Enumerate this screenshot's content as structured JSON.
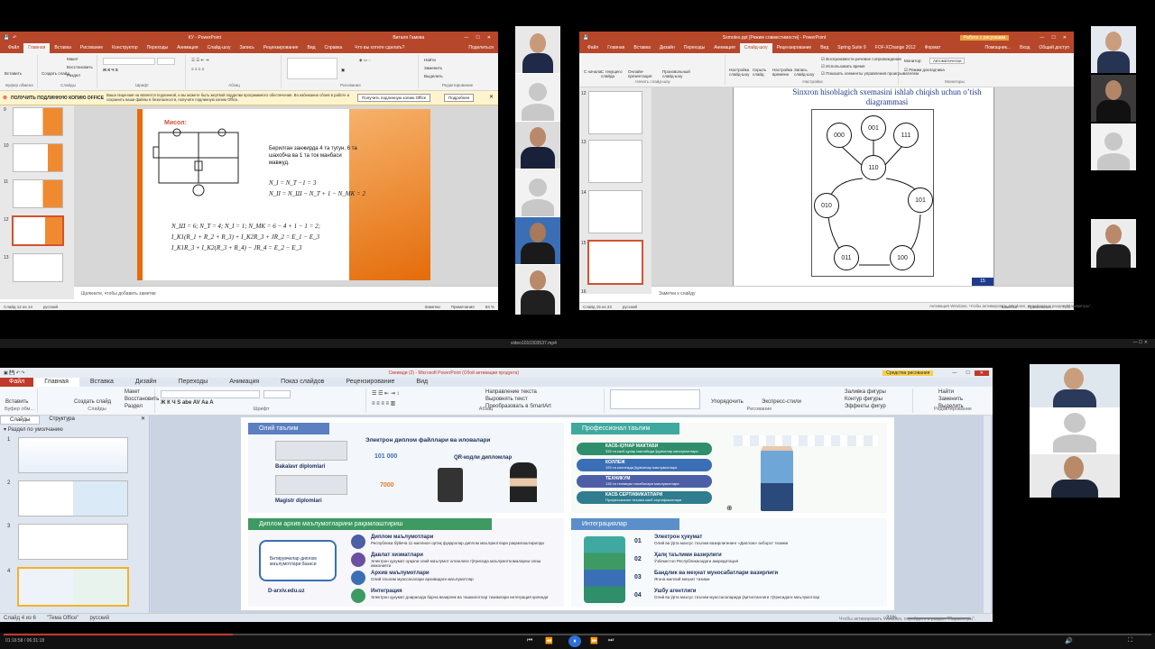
{
  "win1": {
    "title": "КУ - PowerPoint",
    "user": "Виталя Гамева",
    "share": "Поделиться",
    "tabs": [
      "Файл",
      "Главная",
      "Вставка",
      "Рисование",
      "Конструктор",
      "Переходы",
      "Анимация",
      "Слайд-шоу",
      "Запись",
      "Рецензирование",
      "Вид",
      "Справка"
    ],
    "tell": "Что вы хотите сделать?",
    "buttons": [
      "Вставить",
      "Создать слайд",
      "Макет",
      "Восстановить",
      "Раздел",
      "Найти",
      "Заменить",
      "Выделить"
    ],
    "groups": [
      "Буфер обмена",
      "Слайды",
      "Шрифт",
      "Абзац",
      "Рисование",
      "Редактирование"
    ],
    "notice_title": "ПОЛУЧИТЬ ПОДЛИННУЮ КОПИЮ OFFICE",
    "notice_text": "Ваша лицензия на является подлинной, и вы можете быть жертвой подделки программного обеспечения. Во избежание сбоев в работе и сохранить ваши файлы в безопасности, получите подлинную копию Office.",
    "notice_btn1": "Получить подлинную копию Office",
    "notice_btn2": "Подробнее",
    "thumb_nums": [
      "9",
      "10",
      "11",
      "12",
      "13"
    ],
    "slide": {
      "heading": "Мисол:",
      "bullet": "Берилган занжирда 4 та тугун, 6 та шахобча ва 1 та ток манбаси мавжуд.",
      "eq1": "N_I = N_T −1 = 3",
      "eq2": "N_II = N_Ш − N_T + 1 − N_МК = 2",
      "eq3": "N_Ш = 6;   N_T = 4;   N_I = 1; N_МК = 6 − 4 + 1 − 1 = 2;",
      "eq4": "I_K1(R_1 + R_2 + R_3) + I_K2R_3 + JR_2 = E_1 − E_3",
      "eq5": "I_K1R_3 + I_K2(R_3 + R_4) − JR_4 = E_2 − E_3"
    },
    "notes": "Щелкните, чтобы добавить заметки",
    "status_left": "Слайд 12 из 14",
    "status_lang": "русский",
    "status_notes": "Заметки",
    "status_comments": "Примечания",
    "zoom": "83 %"
  },
  "win2": {
    "title": "Sxmotex.ppt [Режим совместимости] - PowerPoint",
    "context": "Работа с рисунками",
    "tabs": [
      "Файл",
      "Главная",
      "Вставка",
      "Дизайн",
      "Переходы",
      "Анимация",
      "Слайд-шоу",
      "Рецензирование",
      "Вид",
      "Spring Suite 9",
      "FOF-XChange 2012",
      "Формат"
    ],
    "help": "Помощник...",
    "login": "Вход",
    "share": "Общий доступ",
    "buttons": [
      "С начала",
      "С текущего слайда",
      "Онлайн-презентация",
      "Произвольный слайд-шоу",
      "Настройка слайд-шоу",
      "Скрыть слайд",
      "Настройка времени",
      "Запись слайд-шоу"
    ],
    "checks": [
      "Воспроизвести речевое сопровождение",
      "Использовать время",
      "Показать элементы управления проигрывателем"
    ],
    "monitor_label": "Монитор:",
    "monitor_value": "Автоматически",
    "presenter": "Режим докладчика",
    "groups": [
      "Начать слайд-шоу",
      "Настройка",
      "Мониторы"
    ],
    "thumb_nums": [
      "12",
      "13",
      "14",
      "15",
      "16"
    ],
    "slide_title": "Sinxron hisoblagich sxemasini ishlab chiqish uchun o’tish diagrammasi",
    "nodes": [
      "000",
      "001",
      "111",
      "110",
      "010",
      "101",
      "011",
      "100"
    ],
    "slide_no": "15",
    "notes": "Заметки к слайду",
    "status_left": "Слайд 15 из 23",
    "status_lang": "русский",
    "status_notes": "Заметки",
    "status_comments": "Примечания",
    "zoom": "73%"
  },
  "top_overlay": "Активация Windows. Чтобы активировать Windows, перейдите в раздел \"Параметры\".",
  "video_title": "video1010303537.mp4",
  "win3": {
    "title": "Свеимди (2) - Microsoft PowerPoint (Сбой активации продукта)",
    "context": "Средства рисования",
    "file_tab": "Файл",
    "tabs": [
      "Главная",
      "Вставка",
      "Дизайн",
      "Переходы",
      "Анимация",
      "Показ слайдов",
      "Рецензирование",
      "Вид"
    ],
    "buttons": [
      "Вставить",
      "Создать слайд",
      "Макет",
      "Восстановить",
      "Раздел",
      "Направление текста",
      "Выровнять текст",
      "Преобразовать в SmartArt",
      "Упорядочить",
      "Экспресс-стили",
      "Заливка фигуры",
      "Контур фигуры",
      "Эффекты фигур",
      "Найти",
      "Заменить",
      "Выделить"
    ],
    "groups": [
      "Буфер обм...",
      "Слайды",
      "Шрифт",
      "Абзац",
      "Рисование",
      "Редактирование"
    ],
    "panel_tabs": [
      "Слайды",
      "Структура"
    ],
    "section": "Раздел по умолчанию",
    "thumb_nums": [
      "1",
      "2",
      "3",
      "4"
    ],
    "card1": {
      "header": "Олий таълим",
      "sub": "Электрон диплом файллари ва иловалари",
      "count1": "101 000",
      "label1": "Bakalavr diplomlari",
      "count2": "7000",
      "label2": "Magistr diplomlari",
      "qr": "QR-кодли дипломлар"
    },
    "card2": {
      "header": "Профессионал таълим",
      "rows": [
        "КАСБ-ҲУНАР МАКТАБИ",
        "КОЛЛЕЖ",
        "ТЕХНИКУМ",
        "КАСБ СЕРТИФИКАТЛАРИ"
      ],
      "descs": [
        "335 та касб-ҳунар мактабида ўқувчилар маълумотлари",
        "193 та коллежда ўқувчилар маълумотлари",
        "135 та техникум талабалари маълумотлари",
        "Профессионал таълим касб сертификатлари"
      ]
    },
    "card3": {
      "header": "Диплом архив маълумотларини рақамлаштириш",
      "caption": "Битирувчилар диплом маълумотлари базаси",
      "link": "D-arxiv.edu.uz",
      "items": [
        "Диплом маълумотлари",
        "Давлат хизматлари",
        "Архив маълумотлари",
        "Интеграция"
      ],
      "descs": [
        "Республика бўйича 11 миллион ортиқ фуқаролар диплом маълумотлари рақамлаштирилди",
        "Электрон ҳукумат орқали олий маълумот олганлиги тўғрисида маълумотномаларни олиш имконияти",
        "Олий таълим муассасалари архивидаги маълумотлар",
        "Электрон ҳукумат доирасида барча вазирлик ва ташкилотлар тизимлари интеграция қилинди"
      ]
    },
    "card4": {
      "header": "Интеграциялар",
      "nums": [
        "01",
        "02",
        "03",
        "04"
      ],
      "items": [
        "Электрон ҳукумат",
        "Ҳалқ таълими вазирлиги",
        "Бандлик ва меҳнат муносабатлари вазирлиги",
        "Ушбу агентлиги"
      ],
      "descs": [
        "Олий ва ўрта махсус таълим вазирлигининг «Диплом» ахборот тизими",
        "Ўзбекистон Республикасидаги аккредитация",
        "Ягона миллий меҳнат тизими",
        "Олий ва ўрта махсус таълим муассасаларида ўқитилганлиги тўғрисидаги маълумотлар"
      ]
    },
    "status_left": "Слайд 4 из 6",
    "status_theme": "\"Тема Office\"",
    "status_lang": "русский",
    "zoom": "21%"
  },
  "bottom_overlay": "Чтобы активировать Windows, перейдите в раздел \"Параметры\".",
  "player_time": "01:16:58 / 06:31:18",
  "accent": "#d35230"
}
